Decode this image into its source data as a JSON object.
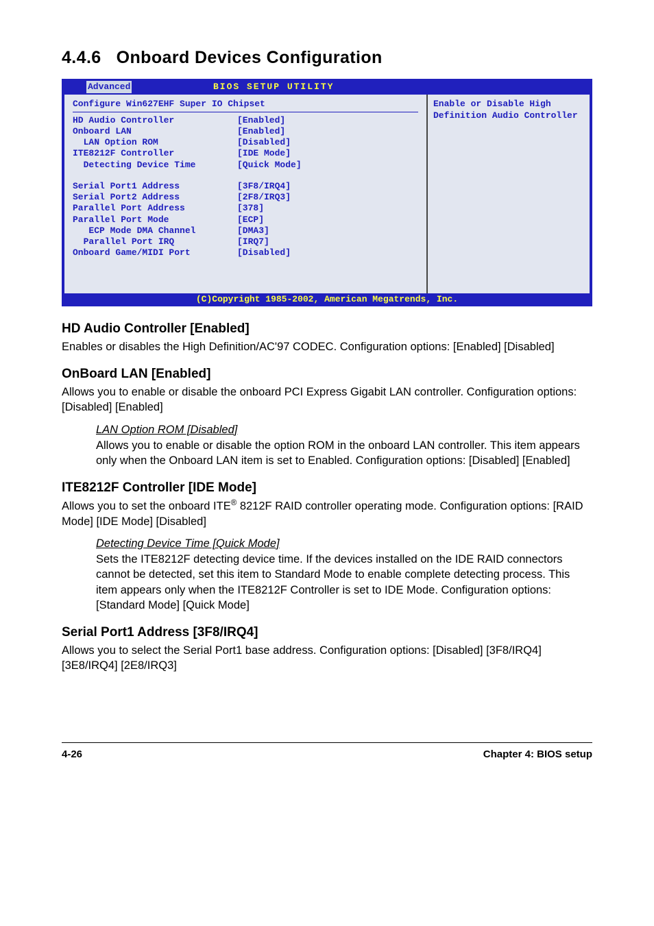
{
  "section": {
    "number": "4.4.6",
    "title": "Onboard Devices Configuration"
  },
  "bios": {
    "header_title": "BIOS SETUP UTILITY",
    "tab": "Advanced",
    "sub_header": "Configure Win627EHF Super IO Chipset",
    "group1": [
      {
        "label": "HD Audio Controller",
        "value": "[Enabled]"
      },
      {
        "label": "Onboard LAN",
        "value": "[Enabled]"
      },
      {
        "label": "  LAN Option ROM",
        "value": "[Disabled]"
      },
      {
        "label": "ITE8212F Controller",
        "value": "[IDE Mode]"
      },
      {
        "label": "  Detecting Device Time",
        "value": "[Quick Mode]"
      }
    ],
    "group2": [
      {
        "label": "Serial Port1 Address",
        "value": "[3F8/IRQ4]"
      },
      {
        "label": "Serial Port2 Address",
        "value": "[2F8/IRQ3]"
      },
      {
        "label": "Parallel Port Address",
        "value": "[378]"
      },
      {
        "label": "Parallel Port Mode",
        "value": "[ECP]"
      },
      {
        "label": "   ECP Mode DMA Channel",
        "value": "[DMA3]"
      },
      {
        "label": "  Parallel Port IRQ",
        "value": "[IRQ7]"
      },
      {
        "label": "Onboard Game/MIDI Port",
        "value": "[Disabled]"
      }
    ],
    "help": "Enable or Disable High Definition Audio Controller",
    "footer": "(C)Copyright 1985-2002, American Megatrends, Inc."
  },
  "settings": {
    "hd_audio": {
      "title": "HD Audio Controller [Enabled]",
      "text": "Enables or disables the High Definition/AC'97 CODEC. Configuration options: [Enabled] [Disabled]"
    },
    "onboard_lan": {
      "title": "OnBoard LAN [Enabled]",
      "text": "Allows you to enable or disable the onboard PCI Express Gigabit LAN controller.  Configuration options: [Disabled] [Enabled]",
      "sub_title": "LAN Option ROM [Disabled]",
      "sub_text": "Allows you to enable or disable the option ROM in the onboard LAN controller. This item appears only when the Onboard LAN item is set to Enabled. Configuration options: [Disabled] [Enabled]"
    },
    "ite": {
      "title": "ITE8212F Controller [IDE Mode]",
      "text_pre": "Allows you to set the onboard ITE",
      "text_post": " 8212F RAID controller operating mode. Configuration options: [RAID Mode] [IDE Mode] [Disabled]",
      "sub_title": "Detecting Device Time [Quick Mode]",
      "sub_text": "Sets the ITE8212F detecting device time. If the devices installed on the IDE RAID connectors cannot be detected, set this item to Standard Mode to enable complete detecting process. This item appears only when the ITE8212F Controller is set to IDE Mode. Configuration options: [Standard Mode] [Quick Mode]"
    },
    "serial1": {
      "title": "Serial Port1 Address [3F8/IRQ4]",
      "text": "Allows you to select the Serial Port1 base address. Configuration options: [Disabled] [3F8/IRQ4] [3E8/IRQ4] [2E8/IRQ3]"
    }
  },
  "footer": {
    "page": "4-26",
    "chapter": "Chapter 4: BIOS setup"
  }
}
